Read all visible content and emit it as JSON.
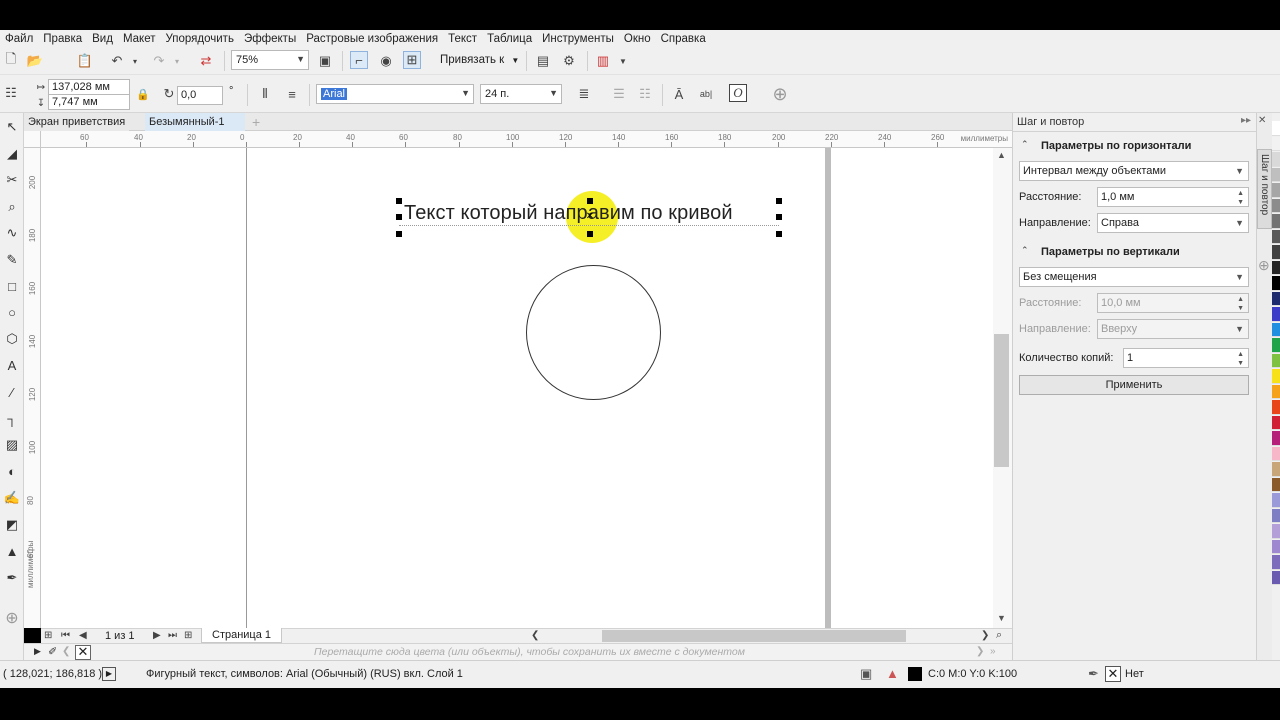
{
  "menu": [
    "Файл",
    "Правка",
    "Вид",
    "Макет",
    "Упорядочить",
    "Эффекты",
    "Растровые изображения",
    "Текст",
    "Таблица",
    "Инструменты",
    "Окно",
    "Справка"
  ],
  "toolbar1": {
    "zoom_value": "75%",
    "snap_label": "Привязать к"
  },
  "toolbar2": {
    "width_value": "137,028 мм",
    "height_value": "7,747 мм",
    "angle_value": "0,0",
    "angle_unit": "°",
    "font_name": "Arial",
    "font_size": "24 п."
  },
  "doc_tabs": {
    "welcome": "Экран приветствия",
    "document": "Безымянный-1"
  },
  "ruler": {
    "h_ticks": [
      "60",
      "40",
      "20",
      "0",
      "20",
      "40",
      "60",
      "80",
      "100",
      "120",
      "140",
      "160",
      "180",
      "200",
      "220",
      "240",
      "260"
    ],
    "h_unit": "миллиметры",
    "v_ticks": [
      "200",
      "180",
      "160",
      "140",
      "120",
      "100",
      "80",
      "60"
    ],
    "v_unit": "миллиметры"
  },
  "canvas": {
    "text_object": "Текст который направим по кривой"
  },
  "page_nav": {
    "counter": "1 из 1",
    "page_tab": "Страница 1"
  },
  "color_hint": "Перетащите сюда цвета (или объекты), чтобы сохранить их вместе с документом",
  "panel": {
    "title": "Шаг и повтор",
    "dock_title": "Шаг и повтор",
    "horizontal_section": "Параметры по горизонтали",
    "horizontal_mode": "Интервал между объектами",
    "h_distance_label": "Расстояние:",
    "h_distance_value": "1,0 мм",
    "h_direction_label": "Направление:",
    "h_direction_value": "Справа",
    "vertical_section": "Параметры по вертикали",
    "vertical_mode": "Без смещения",
    "v_distance_label": "Расстояние:",
    "v_distance_value": "10,0 мм",
    "v_direction_label": "Направление:",
    "v_direction_value": "Вверху",
    "copies_label": "Количество копий:",
    "copies_value": "1",
    "apply_label": "Применить"
  },
  "status": {
    "coords": "( 128,021; 186,818 )",
    "info": "Фигурный текст, символов: Arial (Обычный) (RUS) вкл. Слой 1",
    "fill": "C:0 M:0 Y:0 K:100",
    "outline": "Нет"
  },
  "palette_colors": [
    "#ffffff",
    "#f2f2f2",
    "#d9d9d9",
    "#bfbfbf",
    "#a6a6a6",
    "#8c8c8c",
    "#737373",
    "#595959",
    "#404040",
    "#262626",
    "#000000",
    "#1d2a6e",
    "#3c3cc8",
    "#1f8fe0",
    "#1fa44a",
    "#7fc241",
    "#f6e11a",
    "#f5a21a",
    "#e8451b",
    "#d11f36",
    "#b51f7a",
    "#f7b7c8",
    "#c9a57a",
    "#8a5a2a",
    "#9a9ad8",
    "#7e7ec4",
    "#b49fd8",
    "#9e88cf",
    "#7d6cbc",
    "#6b5bb0"
  ],
  "accent_colors": {
    "highlight": "#f2ec00",
    "selection": "#000000",
    "tab_active": "#dbe9f7"
  }
}
